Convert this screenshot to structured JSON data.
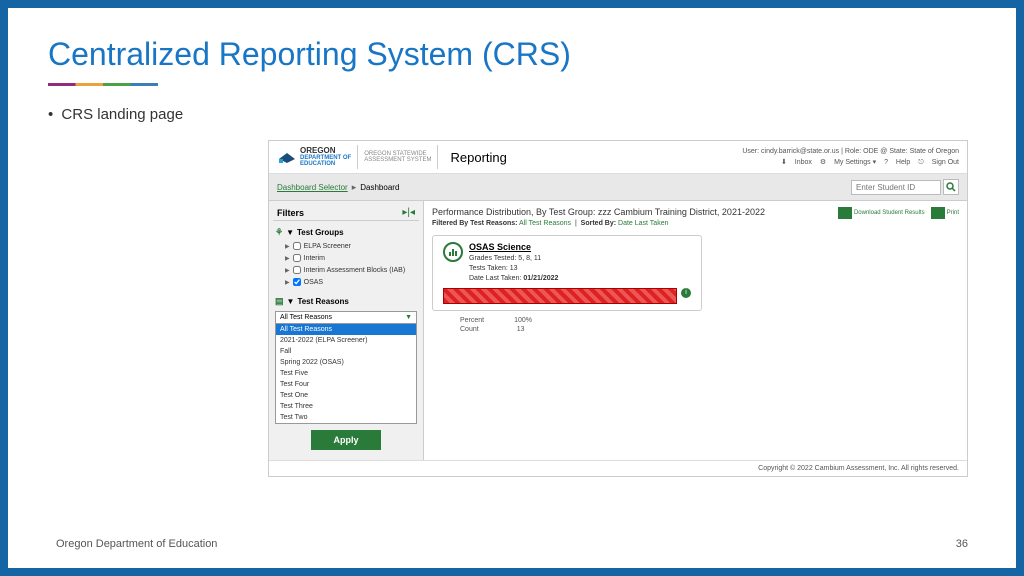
{
  "slide": {
    "title": "Centralized Reporting System (CRS)",
    "bullet": "CRS landing page",
    "footer_left": "Oregon Department of Education",
    "footer_right": "36"
  },
  "header": {
    "logo_top": "OREGON",
    "logo_mid": "DEPARTMENT OF",
    "logo_bot": "EDUCATION",
    "system1": "OREGON STATEWIDE",
    "system2": "ASSESSMENT SYSTEM",
    "app": "Reporting",
    "user": "User: cindy.barrick@state.or.us  |  Role: ODE @ State: State of Oregon",
    "tools": {
      "inbox": "Inbox",
      "settings": "My Settings ▾",
      "help": "Help",
      "signout": "Sign Out"
    }
  },
  "breadcrumb": {
    "a": "Dashboard Selector",
    "b": "Dashboard",
    "search_placeholder": "Enter Student ID"
  },
  "filters": {
    "title": "Filters",
    "groups_label": "Test Groups",
    "groups": [
      {
        "label": "ELPA Screener",
        "checked": false
      },
      {
        "label": "Interim",
        "checked": false
      },
      {
        "label": "Interim Assessment Blocks (IAB)",
        "checked": false
      },
      {
        "label": "OSAS",
        "checked": true
      }
    ],
    "reasons_label": "Test Reasons",
    "reasons_selected": "All Test Reasons",
    "reasons": [
      "All Test Reasons",
      "2021-2022 (ELPA Screener)",
      "Fall",
      "Spring 2022 (OSAS)",
      "Test Five",
      "Test Four",
      "Test One",
      "Test Three",
      "Test Two"
    ],
    "apply": "Apply"
  },
  "main": {
    "title": "Performance Distribution, By Test Group: zzz Cambium Training District, 2021-2022",
    "filtered_by": "Filtered By",
    "tr_label": "Test Reasons:",
    "tr_val": "All Test Reasons",
    "sorted_by": "Sorted By:",
    "sort_val": "Date Last Taken",
    "download": "Download Student Results",
    "print": "Print"
  },
  "card": {
    "title": "OSAS Science",
    "grades_lbl": "Grades Tested:",
    "grades": "5, 8, 11",
    "tests_lbl": "Tests Taken:",
    "tests": "13",
    "date_lbl": "Date Last Taken:",
    "date": "01/21/2022",
    "percent_lbl": "Percent",
    "percent": "100%",
    "count_lbl": "Count",
    "count": "13"
  },
  "copy": "Copyright © 2022 Cambium Assessment, Inc. All rights reserved."
}
